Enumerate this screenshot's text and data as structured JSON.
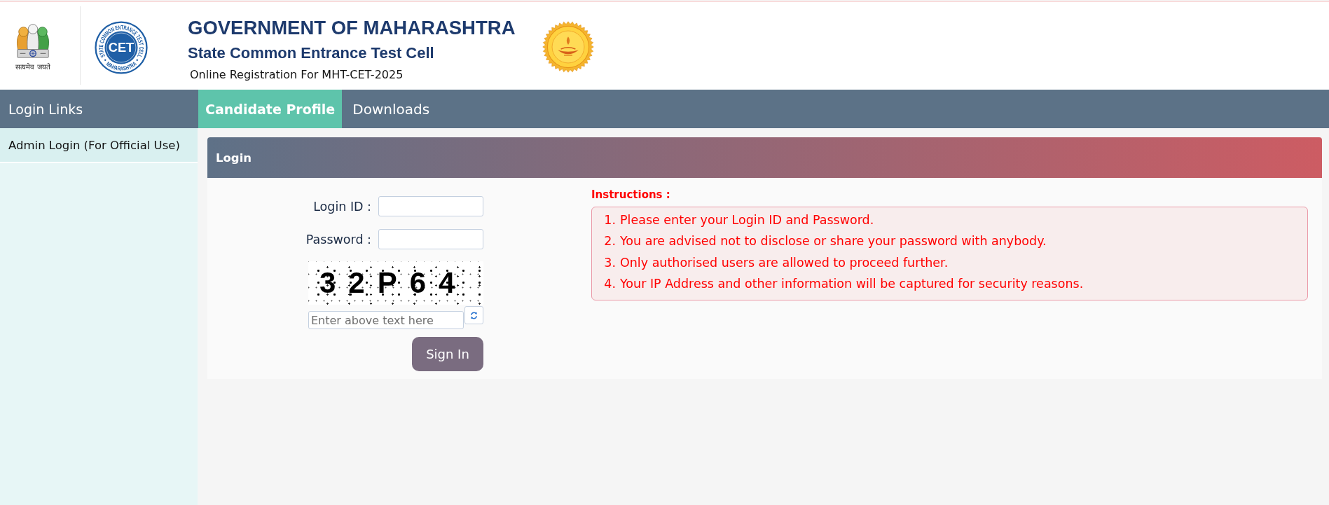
{
  "header": {
    "emblem_motto": "सत्यमेव जयते",
    "cet_logo": {
      "ring_top": "STATE COMMON ENTRANCE TEST CELL",
      "center": "CET",
      "ring_bottom": "MAHARASHTRA"
    },
    "title": "GOVERNMENT OF MAHARASHTRA",
    "subtitle": "State Common Entrance Test Cell",
    "tagline": "Online Registration For MHT-CET-2025"
  },
  "sidebar": {
    "title": "Login Links",
    "items": [
      {
        "label": "Admin Login (For Official Use)"
      }
    ]
  },
  "tabs": [
    {
      "label": "Candidate Profile",
      "selected": true
    },
    {
      "label": "Downloads",
      "selected": false
    }
  ],
  "login": {
    "title": "Login",
    "fields": [
      {
        "label": "Login ID :"
      },
      {
        "label": "Password :"
      }
    ],
    "captcha": {
      "text": "32P64",
      "placeholder": "Enter above text here"
    },
    "submit": "Sign In"
  },
  "instructions": {
    "title": "Instructions :",
    "items": [
      {
        "number": "1.",
        "text": "Please enter your Login ID and Password."
      },
      {
        "number": "2.",
        "text": "You are advised not to disclose or share your password with anybody."
      },
      {
        "number": "3.",
        "text": "Only authorised users are allowed to proceed further."
      },
      {
        "number": "4.",
        "text": "Your IP Address and other information will be captured for security reasons."
      }
    ]
  }
}
